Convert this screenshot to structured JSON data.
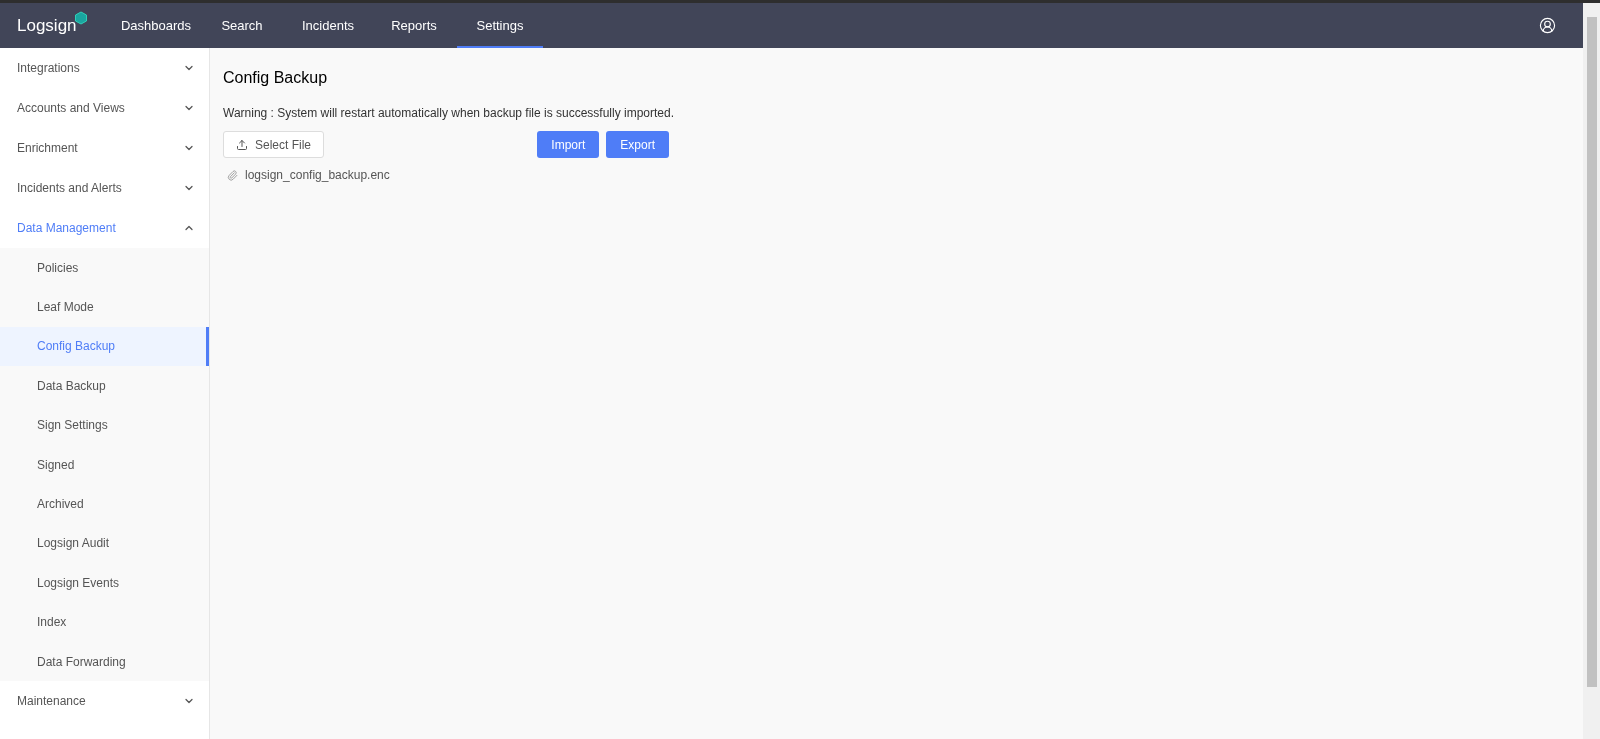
{
  "brand": {
    "name": "Logsign"
  },
  "nav": [
    {
      "label": "Dashboards",
      "selected": false
    },
    {
      "label": "Search",
      "selected": false
    },
    {
      "label": "Incidents",
      "selected": false
    },
    {
      "label": "Reports",
      "selected": false
    },
    {
      "label": "Settings",
      "selected": true
    }
  ],
  "sidebar": {
    "items": [
      {
        "label": "Integrations",
        "expanded": false,
        "selected": false
      },
      {
        "label": "Accounts and Views",
        "expanded": false,
        "selected": false
      },
      {
        "label": "Enrichment",
        "expanded": false,
        "selected": false
      },
      {
        "label": "Incidents and Alerts",
        "expanded": false,
        "selected": false
      },
      {
        "label": "Data Management",
        "expanded": true,
        "selected": true,
        "children": [
          {
            "label": "Policies",
            "selected": false
          },
          {
            "label": "Leaf Mode",
            "selected": false
          },
          {
            "label": "Config Backup",
            "selected": true
          },
          {
            "label": "Data Backup",
            "selected": false
          },
          {
            "label": "Sign Settings",
            "selected": false
          },
          {
            "label": "Signed",
            "selected": false
          },
          {
            "label": "Archived",
            "selected": false
          },
          {
            "label": "Logsign Audit",
            "selected": false
          },
          {
            "label": "Logsign Events",
            "selected": false
          },
          {
            "label": "Index",
            "selected": false
          },
          {
            "label": "Data Forwarding",
            "selected": false
          }
        ]
      },
      {
        "label": "Maintenance",
        "expanded": false,
        "selected": false
      }
    ]
  },
  "page": {
    "title": "Config Backup",
    "warning": "Warning : System will restart automatically when backup file is successfully imported.",
    "select_button": "Select File",
    "buttons": [
      "Import",
      "Export"
    ],
    "file": "logsign_config_backup.enc"
  }
}
